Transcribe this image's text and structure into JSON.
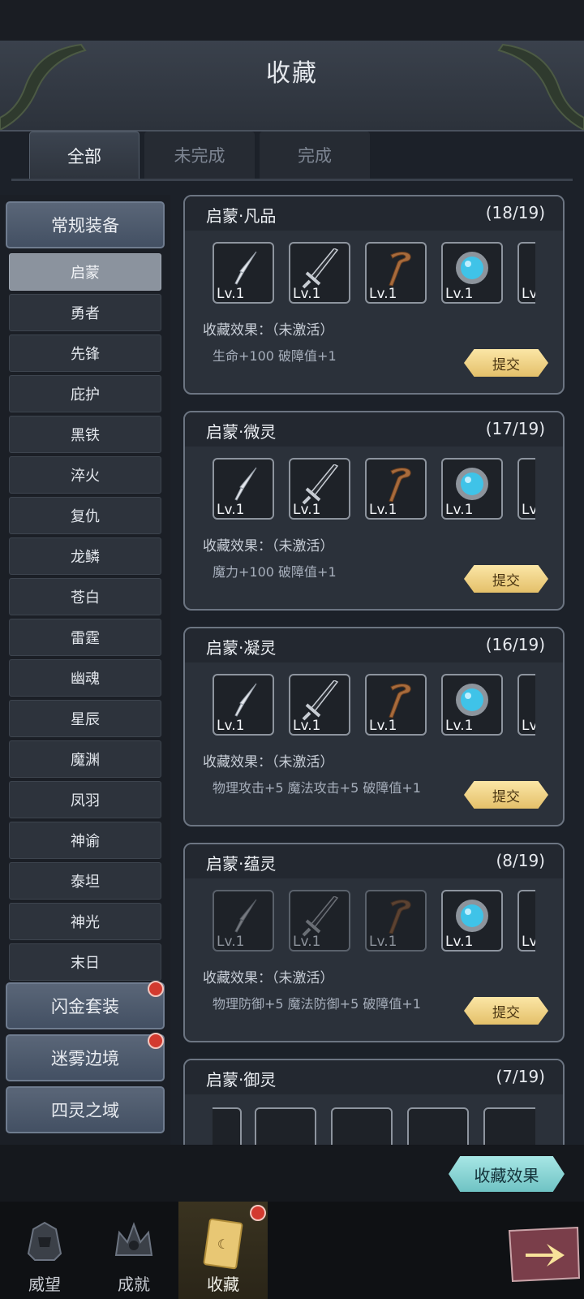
{
  "header": {
    "title": "收藏"
  },
  "tabs": [
    {
      "label": "全部",
      "active": true
    },
    {
      "label": "未完成",
      "active": false
    },
    {
      "label": "完成",
      "active": false
    }
  ],
  "sidebar": {
    "categories": [
      {
        "label": "常规装备",
        "alert": false
      },
      {
        "label": "闪金套装",
        "alert": true
      },
      {
        "label": "迷雾边境",
        "alert": true
      },
      {
        "label": "四灵之域",
        "alert": false
      }
    ],
    "subitems": [
      "启蒙",
      "勇者",
      "先锋",
      "庇护",
      "黑铁",
      "淬火",
      "复仇",
      "龙鳞",
      "苍白",
      "雷霆",
      "幽魂",
      "星辰",
      "魔渊",
      "凤羽",
      "神谕",
      "泰坦",
      "神光",
      "末日"
    ],
    "selected_subitem": "启蒙"
  },
  "cards": [
    {
      "name": "启蒙·凡品",
      "count": "(18/19)",
      "effect_label": "收藏效果：（未激活）",
      "effect_values": "生命+100  破障值+1",
      "submit_label": "提交",
      "items": [
        {
          "level": "Lv.1",
          "icon": "spear-icon",
          "owned": true
        },
        {
          "level": "Lv.1",
          "icon": "sword-icon",
          "owned": true
        },
        {
          "level": "Lv.1",
          "icon": "staff-icon",
          "owned": true
        },
        {
          "level": "Lv.1",
          "icon": "orb-icon",
          "owned": true
        },
        {
          "level": "Lv",
          "icon": "partial-item-icon",
          "owned": true
        }
      ]
    },
    {
      "name": "启蒙·微灵",
      "count": "(17/19)",
      "effect_label": "收藏效果：（未激活）",
      "effect_values": "魔力+100  破障值+1",
      "submit_label": "提交",
      "items": [
        {
          "level": "Lv.1",
          "icon": "spear-icon",
          "owned": true
        },
        {
          "level": "Lv.1",
          "icon": "sword-icon",
          "owned": true
        },
        {
          "level": "Lv.1",
          "icon": "staff-icon",
          "owned": true
        },
        {
          "level": "Lv.1",
          "icon": "orb-icon",
          "owned": true
        },
        {
          "level": "Lv",
          "icon": "partial-item-icon",
          "owned": true
        }
      ]
    },
    {
      "name": "启蒙·凝灵",
      "count": "(16/19)",
      "effect_label": "收藏效果：（未激活）",
      "effect_values": "物理攻击+5  魔法攻击+5  破障值+1",
      "submit_label": "提交",
      "items": [
        {
          "level": "Lv.1",
          "icon": "spear-icon",
          "owned": true
        },
        {
          "level": "Lv.1",
          "icon": "sword-icon",
          "owned": true
        },
        {
          "level": "Lv.1",
          "icon": "staff-icon",
          "owned": true
        },
        {
          "level": "Lv.1",
          "icon": "orb-icon",
          "owned": true
        },
        {
          "level": "Lv",
          "icon": "partial-item-icon",
          "owned": true
        }
      ]
    },
    {
      "name": "启蒙·蕴灵",
      "count": "(8/19)",
      "effect_label": "收藏效果：（未激活）",
      "effect_values": "物理防御+5  魔法防御+5  破障值+1",
      "submit_label": "提交",
      "items": [
        {
          "level": "Lv.1",
          "icon": "spear-icon",
          "owned": false
        },
        {
          "level": "Lv.1",
          "icon": "sword-icon",
          "owned": false
        },
        {
          "level": "Lv.1",
          "icon": "staff-icon",
          "owned": false
        },
        {
          "level": "Lv.1",
          "icon": "orb-icon",
          "owned": true
        },
        {
          "level": "Lv",
          "icon": "partial-item-icon",
          "owned": true
        }
      ]
    },
    {
      "name": "启蒙·御灵",
      "count": "(7/19)"
    }
  ],
  "footer": {
    "effect_button": "收藏效果"
  },
  "nav": [
    {
      "label": "威望",
      "icon": "helmet-icon",
      "active": false,
      "alert": false
    },
    {
      "label": "成就",
      "icon": "crown-icon",
      "active": false,
      "alert": false
    },
    {
      "label": "收藏",
      "icon": "card-icon",
      "active": true,
      "alert": true
    }
  ],
  "colors": {
    "accent_gold": "#e4c06a",
    "effect_teal": "#6fc3c4",
    "alert_red": "#d23a2f",
    "selected_grey": "#8b939e"
  }
}
